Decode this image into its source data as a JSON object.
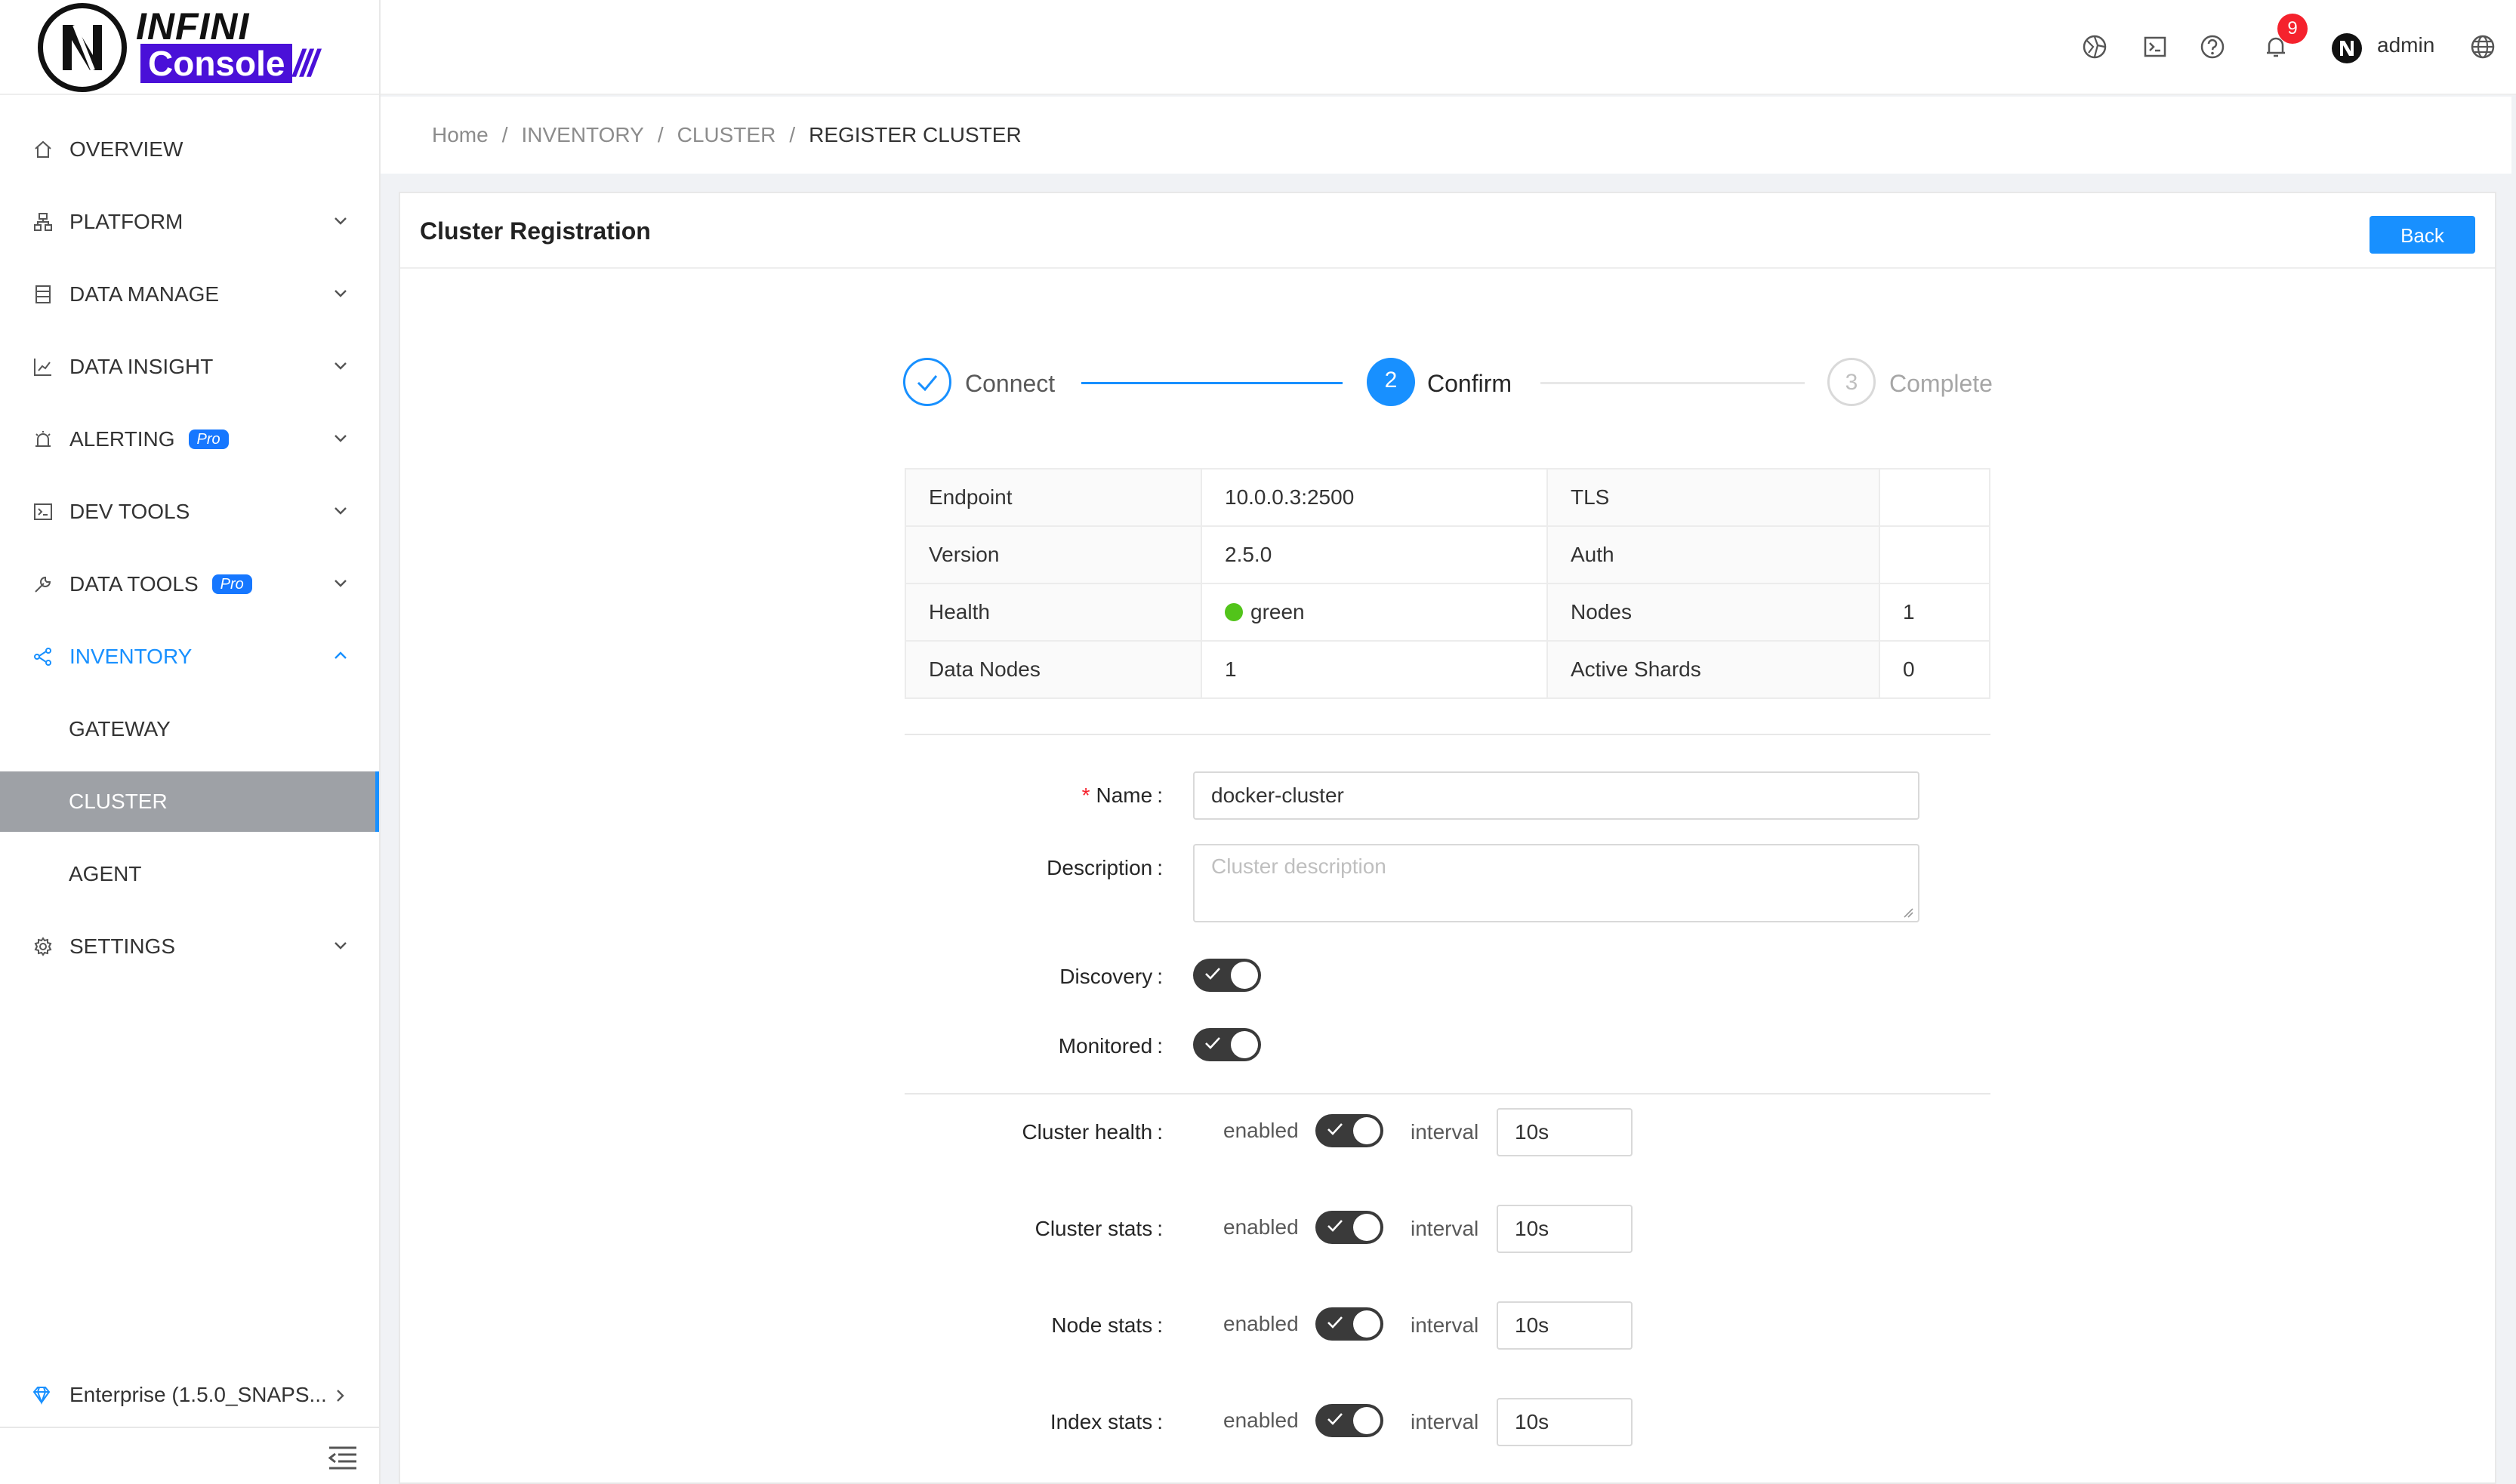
{
  "brand": {
    "name_top": "INFINI",
    "name_bottom": "Console",
    "bars": "///"
  },
  "sidebar": {
    "items": [
      {
        "label": "OVERVIEW",
        "icon": "home-icon"
      },
      {
        "label": "PLATFORM",
        "icon": "platform-icon"
      },
      {
        "label": "DATA MANAGE",
        "icon": "database-icon"
      },
      {
        "label": "DATA INSIGHT",
        "icon": "chart-icon"
      },
      {
        "label": "ALERTING",
        "icon": "alarm-icon",
        "badge": "Pro"
      },
      {
        "label": "DEV TOOLS",
        "icon": "code-icon"
      },
      {
        "label": "DATA TOOLS",
        "icon": "tool-icon",
        "badge": "Pro"
      },
      {
        "label": "INVENTORY",
        "icon": "share-icon"
      },
      {
        "label": "GATEWAY"
      },
      {
        "label": "CLUSTER"
      },
      {
        "label": "AGENT"
      },
      {
        "label": "SETTINGS",
        "icon": "gear-icon"
      }
    ],
    "footer": "Enterprise (1.5.0_SNAPS..."
  },
  "header": {
    "notification_count": "9",
    "user": "admin"
  },
  "breadcrumb": [
    "Home",
    "INVENTORY",
    "CLUSTER",
    "REGISTER CLUSTER"
  ],
  "card": {
    "title": "Cluster Registration",
    "back_label": "Back"
  },
  "steps": [
    {
      "label": "Connect",
      "status": "finished"
    },
    {
      "number": "2",
      "label": "Confirm",
      "status": "active"
    },
    {
      "number": "3",
      "label": "Complete",
      "status": "waiting"
    }
  ],
  "info": {
    "rows": [
      {
        "l1": "Endpoint",
        "v1": "10.0.0.3:2500",
        "l2": "TLS",
        "v2": ""
      },
      {
        "l1": "Version",
        "v1": "2.5.0",
        "l2": "Auth",
        "v2": ""
      },
      {
        "l1": "Health",
        "v1": "green",
        "l2": "Nodes",
        "v2": "1"
      },
      {
        "l1": "Data Nodes",
        "v1": "1",
        "l2": "Active Shards",
        "v2": "0"
      }
    ]
  },
  "form": {
    "name_label": "Name",
    "name_value": "docker-cluster",
    "description_label": "Description",
    "description_placeholder": "Cluster description",
    "discovery_label": "Discovery",
    "monitored_label": "Monitored",
    "colon": ":",
    "enabled_text": "enabled",
    "interval_text": "interval",
    "metrics": [
      {
        "label": "Cluster health",
        "interval": "10s"
      },
      {
        "label": "Cluster stats",
        "interval": "10s"
      },
      {
        "label": "Node stats",
        "interval": "10s"
      },
      {
        "label": "Index stats",
        "interval": "10s"
      }
    ]
  },
  "colors": {
    "primary": "#1890ff",
    "brand": "#4a10d8",
    "health_green": "#52c41a"
  }
}
